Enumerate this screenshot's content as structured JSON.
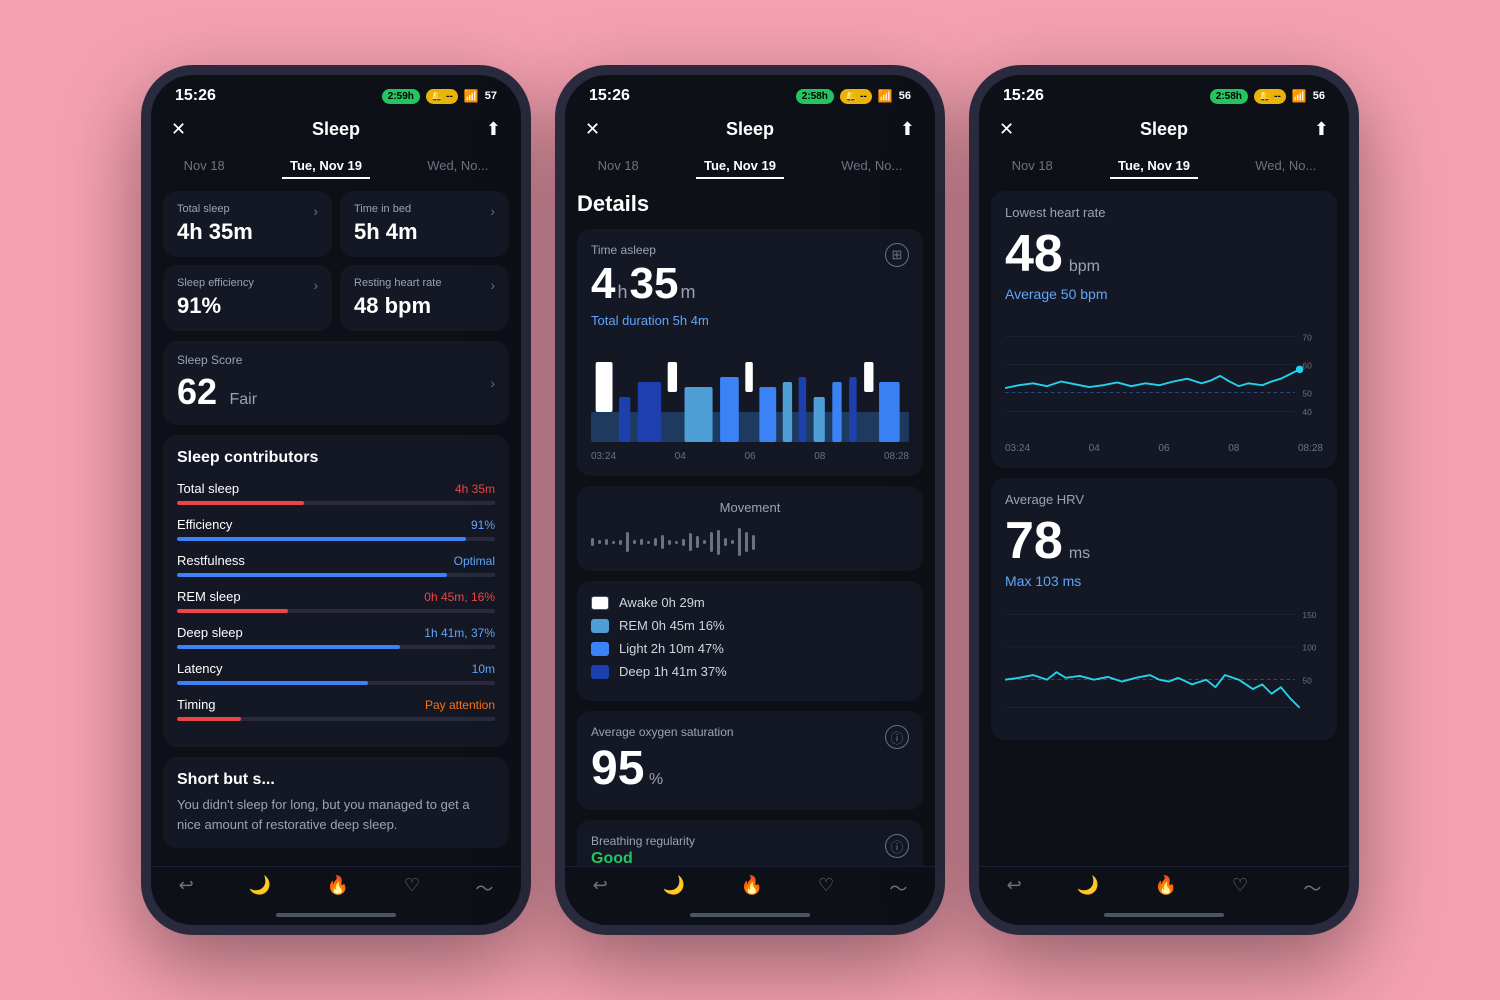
{
  "phone1": {
    "status": {
      "time": "15:26",
      "duration": "2:59h",
      "battery": "57"
    },
    "nav": {
      "title": "Sleep",
      "close": "✕",
      "share": "⬆"
    },
    "dates": {
      "prev": "Nov 18",
      "current": "Tue, Nov 19",
      "next": "Wed, No..."
    },
    "stats": [
      {
        "label": "Total sleep",
        "value": "4h 35m"
      },
      {
        "label": "Time in bed",
        "value": "5h 4m"
      },
      {
        "label": "Sleep efficiency",
        "value": "91%"
      },
      {
        "label": "Resting heart rate",
        "value": "48 bpm"
      }
    ],
    "score": {
      "label": "Sleep Score",
      "value": "62",
      "desc": "Fair"
    },
    "contributors_title": "Sleep contributors",
    "contributors": [
      {
        "name": "Total sleep",
        "value": "4h 35m",
        "color": "red",
        "pct": 40
      },
      {
        "name": "Efficiency",
        "value": "91%",
        "color": "blue",
        "pct": 91
      },
      {
        "name": "Restfulness",
        "value": "Optimal",
        "color": "blue",
        "pct": 85
      },
      {
        "name": "REM sleep",
        "value": "0h 45m, 16%",
        "color": "red",
        "pct": 35
      },
      {
        "name": "Deep sleep",
        "value": "1h 41m, 37%",
        "color": "blue",
        "pct": 70
      },
      {
        "name": "Latency",
        "value": "10m",
        "color": "blue",
        "pct": 60
      },
      {
        "name": "Timing",
        "value": "Pay attention",
        "color": "orange",
        "pct": 20
      }
    ],
    "summary": {
      "title": "Short but s...",
      "text": "You didn't sleep for long, but you managed to get a nice amount of restorative deep sleep."
    }
  },
  "phone2": {
    "status": {
      "time": "15:26",
      "duration": "2:58h",
      "battery": "56"
    },
    "nav": {
      "title": "Sleep"
    },
    "dates": {
      "prev": "Nov 18",
      "current": "Tue, Nov 19",
      "next": "Wed, No..."
    },
    "details_title": "Details",
    "time_asleep_label": "Time asleep",
    "time_asleep_h": "4",
    "time_asleep_m": "35",
    "total_duration": "Total duration 5h 4m",
    "chart_times": [
      "03:24",
      "04",
      "06",
      "08",
      "08:28"
    ],
    "movement_title": "Movement",
    "legend": [
      {
        "color": "#ffffff",
        "text": "Awake 0h 29m"
      },
      {
        "color": "#4d9fd6",
        "text": "REM 0h 45m 16%"
      },
      {
        "color": "#3b82f6",
        "text": "Light 2h 10m 47%"
      },
      {
        "color": "#1e40af",
        "text": "Deep 1h 41m 37%"
      }
    ],
    "oxygen_label": "Average oxygen saturation",
    "oxygen_value": "95",
    "oxygen_unit": "%",
    "breathing_label": "Breathing regularity",
    "breathing_value": "Good"
  },
  "phone3": {
    "status": {
      "time": "15:26",
      "duration": "2:58h",
      "battery": "56"
    },
    "nav": {
      "title": "Sleep"
    },
    "dates": {
      "prev": "Nov 18",
      "current": "Tue, Nov 19",
      "next": "Wed, No..."
    },
    "hr_label": "Lowest heart rate",
    "hr_value": "48",
    "hr_unit": "bpm",
    "hr_avg": "Average 50 bpm",
    "hr_chart_times": [
      "03:24",
      "04",
      "06",
      "08",
      "08:28"
    ],
    "hr_axis": [
      "70",
      "60",
      "50",
      "40"
    ],
    "hrv_label": "Average HRV",
    "hrv_value": "78",
    "hrv_unit": "ms",
    "hrv_max": "Max 103 ms",
    "hrv_axis": [
      "150",
      "100",
      "50"
    ]
  },
  "bottom_nav_icons": [
    "↩",
    "🌙",
    "🔥",
    "♡",
    "〜"
  ]
}
